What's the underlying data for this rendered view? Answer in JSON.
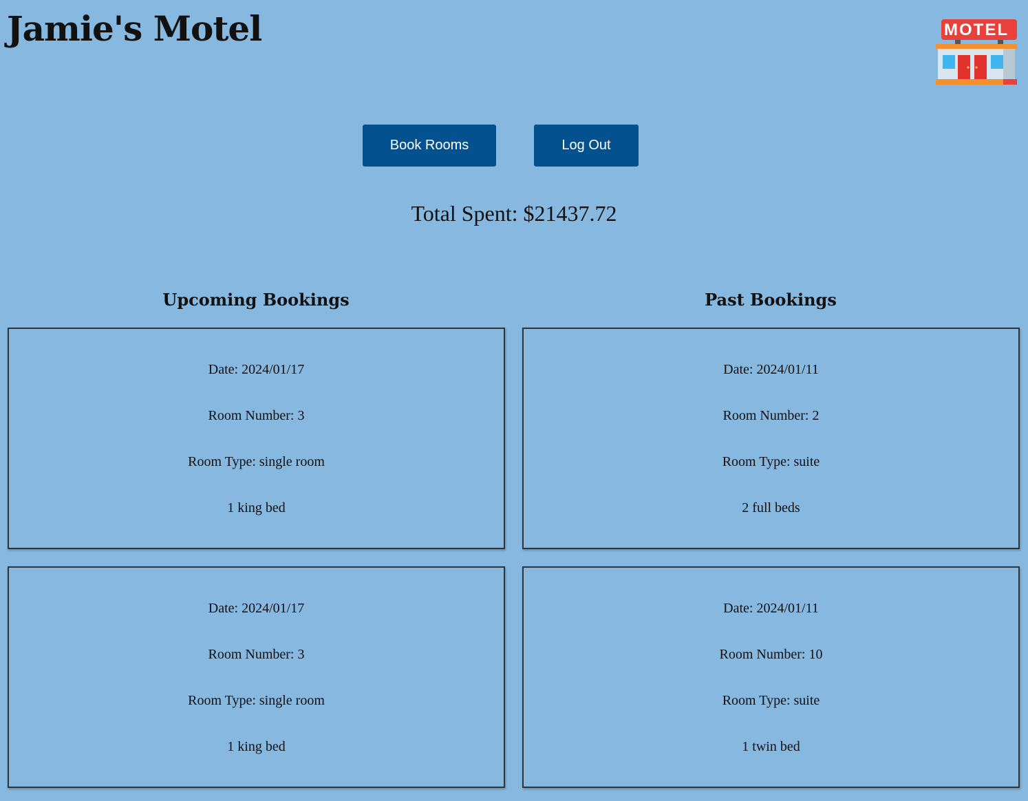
{
  "header": {
    "title": "Jamie's Motel",
    "logo_icon": "motel-building-icon",
    "logo_sign_text": "MOTEL"
  },
  "actions": {
    "book_label": "Book Rooms",
    "logout_label": "Log Out"
  },
  "summary": {
    "total_spent": "Total Spent: $21437.72"
  },
  "upcoming": {
    "title": "Upcoming Bookings",
    "bookings": [
      {
        "date": "Date: 2024/01/17",
        "room_number": "Room Number: 3",
        "room_type": "Room Type: single room",
        "beds": "1 king bed"
      },
      {
        "date": "Date: 2024/01/17",
        "room_number": "Room Number: 3",
        "room_type": "Room Type: single room",
        "beds": "1 king bed"
      }
    ]
  },
  "past": {
    "title": "Past Bookings",
    "bookings": [
      {
        "date": "Date: 2024/01/11",
        "room_number": "Room Number: 2",
        "room_type": "Room Type: suite",
        "beds": "2 full beds"
      },
      {
        "date": "Date: 2024/01/11",
        "room_number": "Room Number: 10",
        "room_type": "Room Type: suite",
        "beds": "1 twin bed"
      }
    ]
  },
  "colors": {
    "background": "#86b8e0",
    "button": "#03518e",
    "button_text": "#ffffff",
    "card_border": "#333333"
  }
}
